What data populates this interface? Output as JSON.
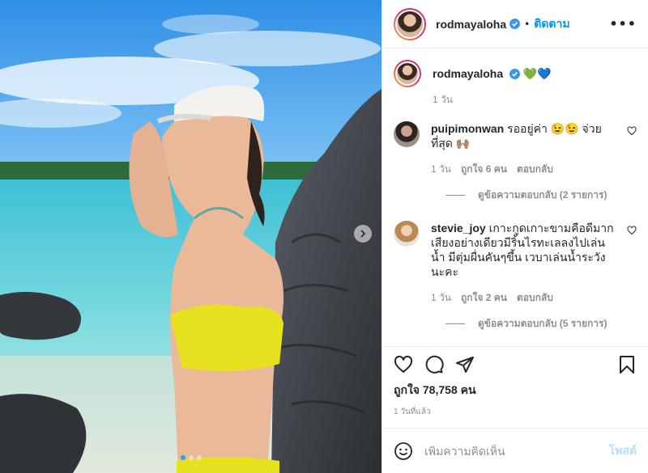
{
  "post": {
    "author": "rodmayaloha",
    "follow_label": "ติดตาม",
    "separator": "•",
    "more_label": "•••",
    "caption": {
      "username": "rodmayaloha",
      "text": "💚💙",
      "time": "1 วัน"
    },
    "comments": [
      {
        "username": "puipimonwan",
        "text": "รออยู่ค่า 😉😉 จ่วยที่สุด 🙌🏽",
        "time": "1 วัน",
        "likes": "ถูกใจ 6 คน",
        "reply_label": "ตอบกลับ",
        "view_replies": "ดูข้อความตอบกลับ (2 รายการ)"
      },
      {
        "username": "stevie_joy",
        "text": "เกาะกูดเกาะขามคือดีมาก เสียงอย่างเดียวมีริ้นไรทะเลลงไปเล่นน้ำ มีตุ่มผื่นคันๆขึ้น เวบาเล่นน้ำระวังนะคะ",
        "time": "1 วัน",
        "likes": "ถูกใจ 2 คน",
        "reply_label": "ตอบกลับ",
        "view_replies": "ดูข้อความตอบกลับ (5 รายการ)"
      }
    ],
    "likes_text": "ถูกใจ 78,758 คน",
    "posted_ago": "1 วันที่แล้ว",
    "add_comment_placeholder": "เพิ่มความคิดเห็น",
    "post_button_label": "โพสต์"
  },
  "carousel": {
    "total_slides": 3,
    "active_slide": 1
  },
  "icons": {
    "verified": "verified-badge-icon",
    "like": "heart-icon",
    "comment": "comment-icon",
    "share": "share-icon",
    "save": "bookmark-icon",
    "emoji": "emoji-icon",
    "next": "chevron-right-icon"
  },
  "colors": {
    "accent": "#0095f6",
    "verified": "#3897f0",
    "muted": "#8e8e8e",
    "post_disabled": "#b2dffc"
  }
}
